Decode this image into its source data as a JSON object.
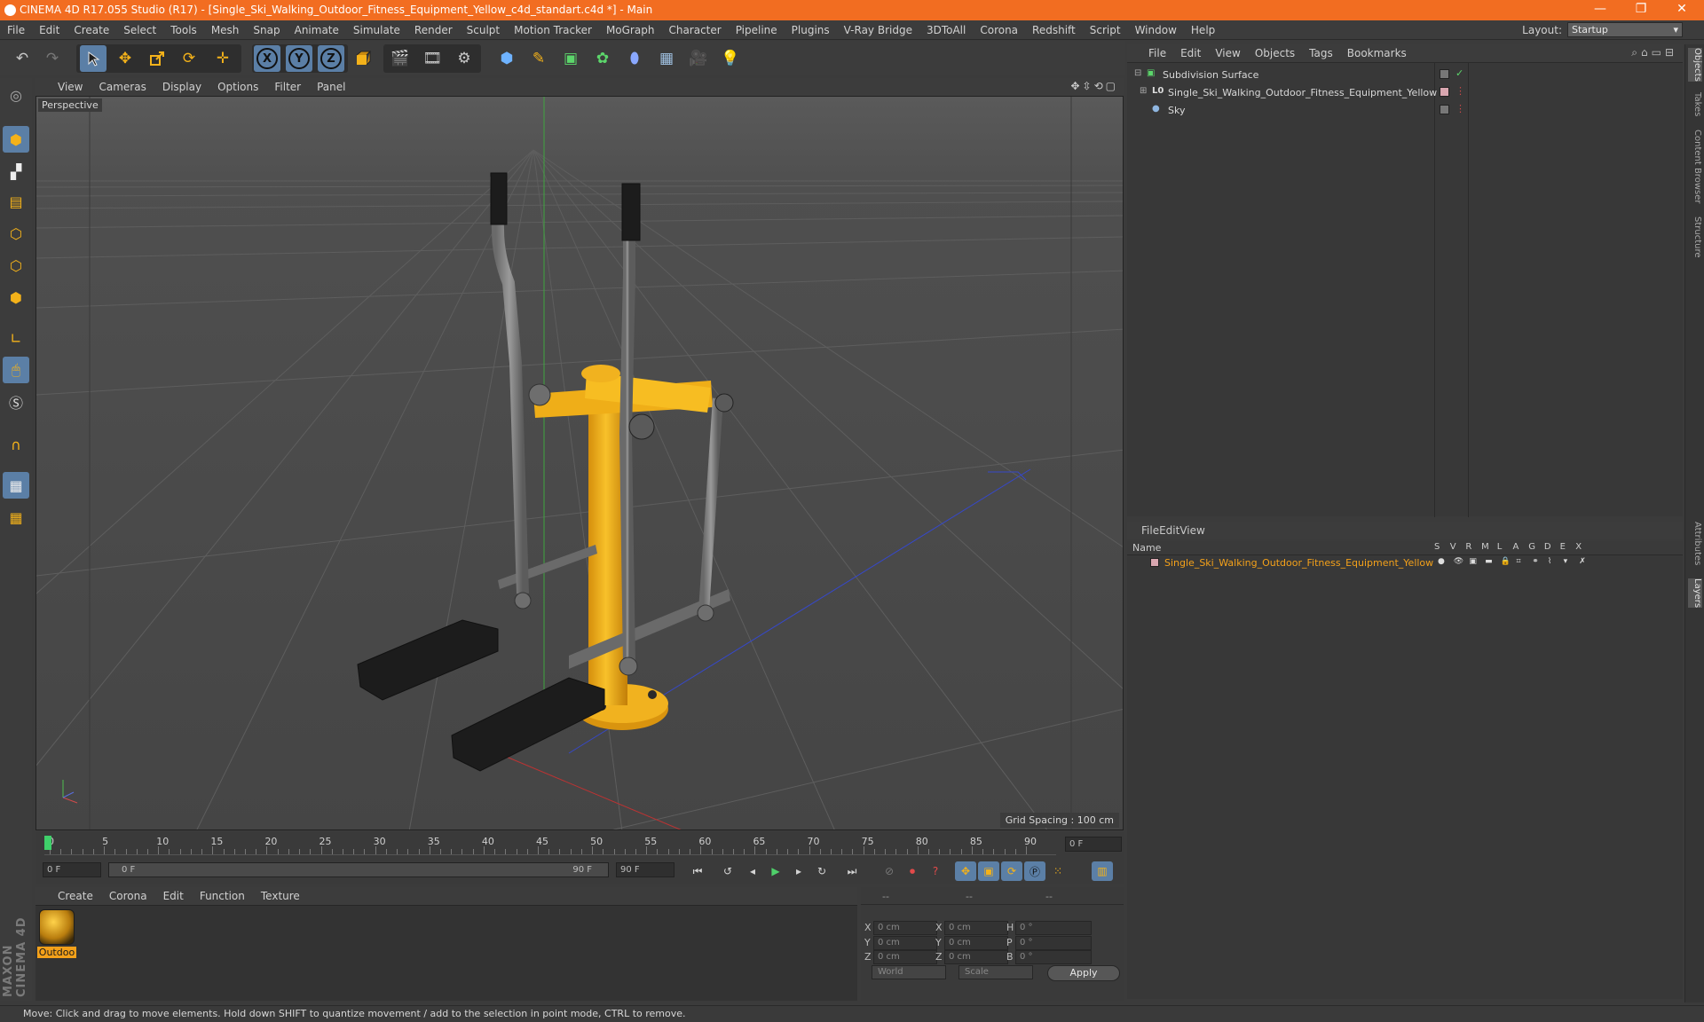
{
  "window": {
    "title": "CINEMA 4D R17.055 Studio (R17) - [Single_Ski_Walking_Outdoor_Fitness_Equipment_Yellow_c4d_standart.c4d *] - Main",
    "controls": [
      "—",
      "❐",
      "✕"
    ]
  },
  "menubar": {
    "items": [
      "File",
      "Edit",
      "Create",
      "Select",
      "Tools",
      "Mesh",
      "Snap",
      "Animate",
      "Simulate",
      "Render",
      "Sculpt",
      "Motion Tracker",
      "MoGraph",
      "Character",
      "Pipeline",
      "Plugins",
      "V-Ray Bridge",
      "3DToAll",
      "Corona",
      "Redshift",
      "Script",
      "Window",
      "Help"
    ],
    "layout_label": "Layout:",
    "layout_value": "Startup"
  },
  "toolbar": {
    "icons": [
      "undo-icon",
      "redo-icon",
      "select-arrow-icon",
      "move-icon",
      "scale-icon",
      "rotate-icon",
      "live-select-icon",
      "x-axis-icon",
      "y-axis-icon",
      "z-axis-icon",
      "world-coordinates-icon",
      "render-view-icon",
      "render-picture-viewer-icon",
      "edit-render-settings-icon",
      "cube-object-icon",
      "pen-spline-icon",
      "subdivision-icon",
      "array-icon",
      "deformer-icon",
      "floor-icon",
      "camera-icon",
      "light-icon"
    ],
    "axis_x": "X",
    "axis_y": "Y",
    "axis_z": "Z"
  },
  "viewport": {
    "menu": [
      "View",
      "Cameras",
      "Display",
      "Options",
      "Filter",
      "Panel"
    ],
    "label": "Perspective",
    "grid_spacing": "Grid Spacing : 100 cm"
  },
  "timeline": {
    "ticks": [
      "0",
      "5",
      "10",
      "15",
      "20",
      "25",
      "30",
      "35",
      "40",
      "45",
      "50",
      "55",
      "60",
      "65",
      "70",
      "75",
      "80",
      "85",
      "90"
    ],
    "current_frame": "0 F",
    "start_field": "0 F",
    "range_start": "0 F",
    "range_end": "90 F",
    "end_field": "90 F"
  },
  "material_manager": {
    "menu": [
      "Create",
      "Corona",
      "Edit",
      "Function",
      "Texture"
    ],
    "material_name": "Outdoo"
  },
  "coordinates": {
    "header": [
      "--",
      "--",
      "--"
    ],
    "rows": [
      {
        "a": "X",
        "av": "0 cm",
        "b": "X",
        "bv": "0 cm",
        "c": "H",
        "cv": "0 °"
      },
      {
        "a": "Y",
        "av": "0 cm",
        "b": "Y",
        "bv": "0 cm",
        "c": "P",
        "cv": "0 °"
      },
      {
        "a": "Z",
        "av": "0 cm",
        "b": "Z",
        "bv": "0 cm",
        "c": "B",
        "cv": "0 °"
      }
    ],
    "mode1": "World",
    "mode2": "Scale",
    "apply": "Apply"
  },
  "object_manager": {
    "menu": [
      "File",
      "Edit",
      "View",
      "Objects",
      "Tags",
      "Bookmarks"
    ],
    "objects": [
      {
        "name": "Subdivision Surface",
        "color": "#d8d8d8"
      },
      {
        "name": "Single_Ski_Walking_Outdoor_Fitness_Equipment_Yellow",
        "color": "#d8d8d8"
      },
      {
        "name": "Sky",
        "color": "#d8d8d8"
      }
    ]
  },
  "layer_manager": {
    "menu": [
      "File",
      "Edit",
      "View"
    ],
    "header_name": "Name",
    "columns": [
      "S",
      "V",
      "R",
      "M",
      "L",
      "A",
      "G",
      "D",
      "E",
      "X"
    ],
    "layers": [
      {
        "name": "Single_Ski_Walking_Outdoor_Fitness_Equipment_Yellow",
        "color": "#f4a11a"
      }
    ]
  },
  "edge_tabs": [
    "Objects",
    "Takes",
    "Content Browser",
    "Structure",
    "Attributes",
    "Layers"
  ],
  "brand": "MAXON CINEMA 4D",
  "status": "Move: Click and drag to move elements. Hold down SHIFT to quantize movement / add to the selection in point mode, CTRL to remove.",
  "colors": {
    "titlebar": "#f26d21",
    "accent_blue": "#5b7fa6",
    "equipment_yellow": "#f4b21a"
  }
}
